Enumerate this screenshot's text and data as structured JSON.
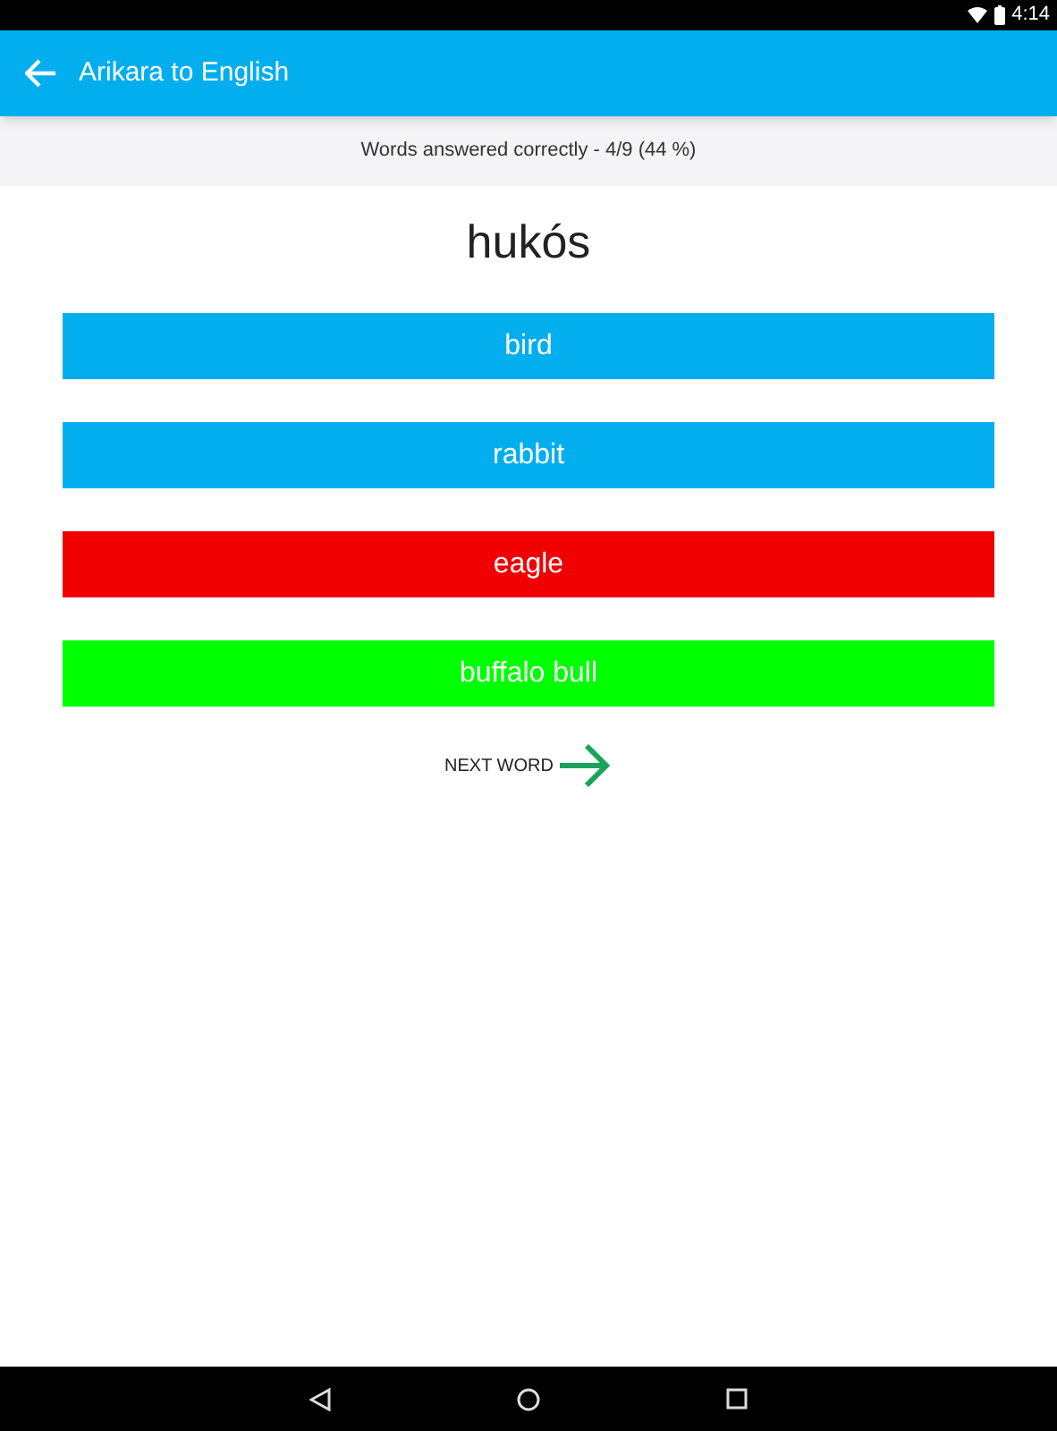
{
  "status_bar": {
    "time": "4:14"
  },
  "app_bar": {
    "title": "Arikara to English"
  },
  "score": "Words answered correctly - 4/9 (44 %)",
  "word": "hukós",
  "answers": [
    {
      "label": "bird",
      "kind": "neutral"
    },
    {
      "label": "rabbit",
      "kind": "neutral"
    },
    {
      "label": "eagle",
      "kind": "wrong"
    },
    {
      "label": "buffalo bull",
      "kind": "correct"
    }
  ],
  "next_button": {
    "label": "NEXT WORD"
  }
}
